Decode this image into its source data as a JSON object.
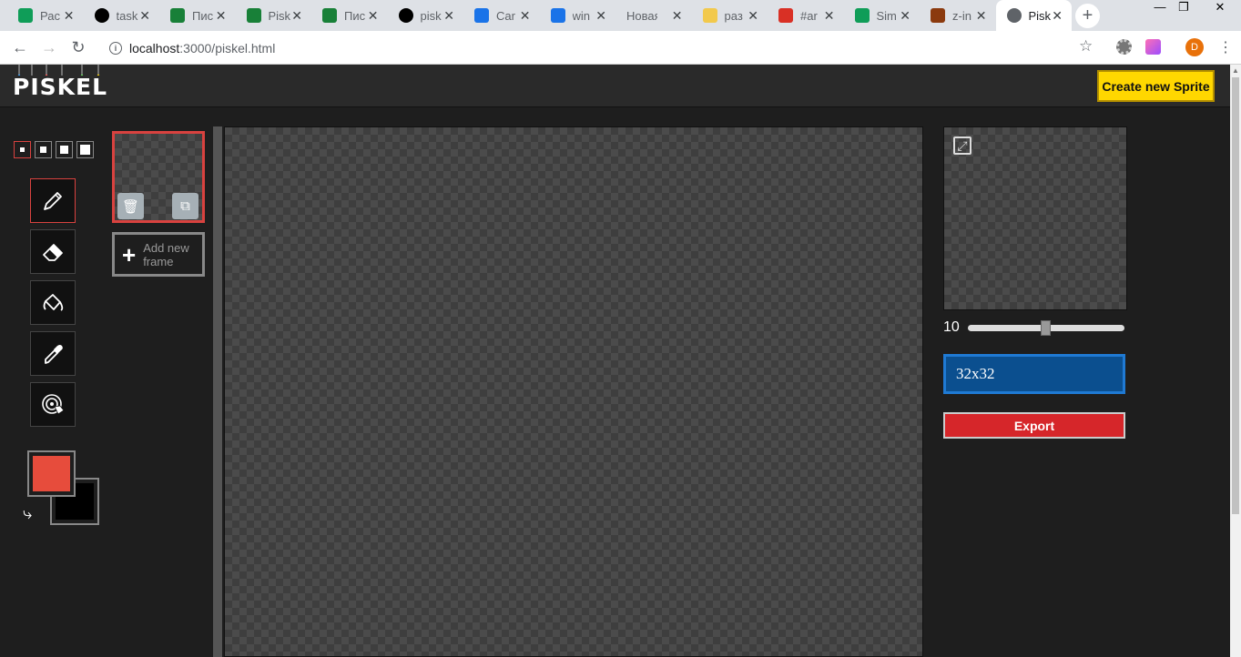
{
  "browser": {
    "tabs": [
      {
        "title": "Рас",
        "icon": "sheets-plus-icon",
        "color": "#0f9d58"
      },
      {
        "title": "task",
        "icon": "github-icon",
        "color": "#000000"
      },
      {
        "title": "Пис",
        "icon": "sheets-grid-icon",
        "color": "#188038"
      },
      {
        "title": "Pisk",
        "icon": "sheets-grid-icon",
        "color": "#188038"
      },
      {
        "title": "Пис",
        "icon": "sheets-grid-icon",
        "color": "#188038"
      },
      {
        "title": "pisk",
        "icon": "github-icon",
        "color": "#000000"
      },
      {
        "title": "Car",
        "icon": "graduation-cap-icon",
        "color": "#1a73e8"
      },
      {
        "title": "win",
        "icon": "graduation-cap-icon",
        "color": "#1a73e8"
      },
      {
        "title": "Новая в",
        "icon": "",
        "color": ""
      },
      {
        "title": "раз",
        "icon": "dollar-coin-icon",
        "color": "#f2c94c"
      },
      {
        "title": "#ar",
        "icon": "calendar-alert-icon",
        "color": "#d93025"
      },
      {
        "title": "Sim",
        "icon": "sheets-plus-icon",
        "color": "#0f9d58"
      },
      {
        "title": "z-in",
        "icon": "brick-icon",
        "color": "#8b3a0e"
      },
      {
        "title": "Pisk",
        "icon": "globe-icon",
        "color": "#5f6368"
      }
    ],
    "active_tab": 13,
    "url_host": "localhost",
    "url_path": ":3000/piskel.html",
    "avatar_letter": "D"
  },
  "app": {
    "logo": "PISKEL",
    "create_button": "Create new Sprite",
    "pen_sizes": [
      1,
      2,
      3,
      4
    ],
    "selected_pen_size": 1,
    "tools": [
      {
        "name": "pen-tool",
        "icon": "pencil-icon",
        "selected": true
      },
      {
        "name": "eraser-tool",
        "icon": "eraser-icon",
        "selected": false
      },
      {
        "name": "paint-bucket-tool",
        "icon": "paint-bucket-icon",
        "selected": false
      },
      {
        "name": "color-picker-tool",
        "icon": "eyedropper-icon",
        "selected": false
      },
      {
        "name": "same-color-bucket-tool",
        "icon": "target-hand-icon",
        "selected": false
      }
    ],
    "primary_color": "#e74c3c",
    "secondary_color": "#000000",
    "add_frame_label": "Add new frame",
    "fps": "10",
    "fps_fraction": 0.5,
    "size_label": "32x32",
    "export_label": "Export"
  }
}
